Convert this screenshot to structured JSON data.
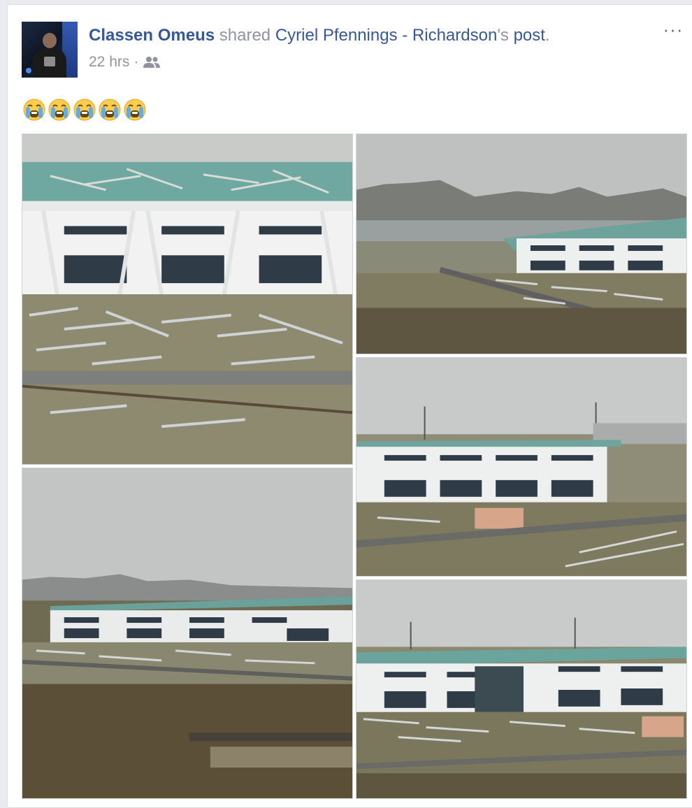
{
  "post": {
    "author": "Classen Omeus",
    "action": "shared",
    "original_author": "Cyriel Pfennings - Richardson",
    "possessive_suffix": "'s",
    "object": "post",
    "period": ".",
    "timestamp": "22 hrs",
    "separator": "·",
    "audience_icon": "friends-icon",
    "more_icon": "more-options-icon",
    "more_label": "···",
    "text_emojis": [
      "loudly-crying-face",
      "loudly-crying-face",
      "loudly-crying-face",
      "loudly-crying-face",
      "loudly-crying-face"
    ]
  },
  "photos": [
    {
      "name": "photo-1",
      "description_icon": "photo"
    },
    {
      "name": "photo-2",
      "description_icon": "photo"
    },
    {
      "name": "photo-3",
      "description_icon": "photo"
    },
    {
      "name": "photo-4",
      "description_icon": "photo"
    },
    {
      "name": "photo-5",
      "description_icon": "photo"
    }
  ],
  "colors": {
    "link": "#365899",
    "meta": "#90949c",
    "background": "#e9ebee",
    "card": "#ffffff"
  }
}
